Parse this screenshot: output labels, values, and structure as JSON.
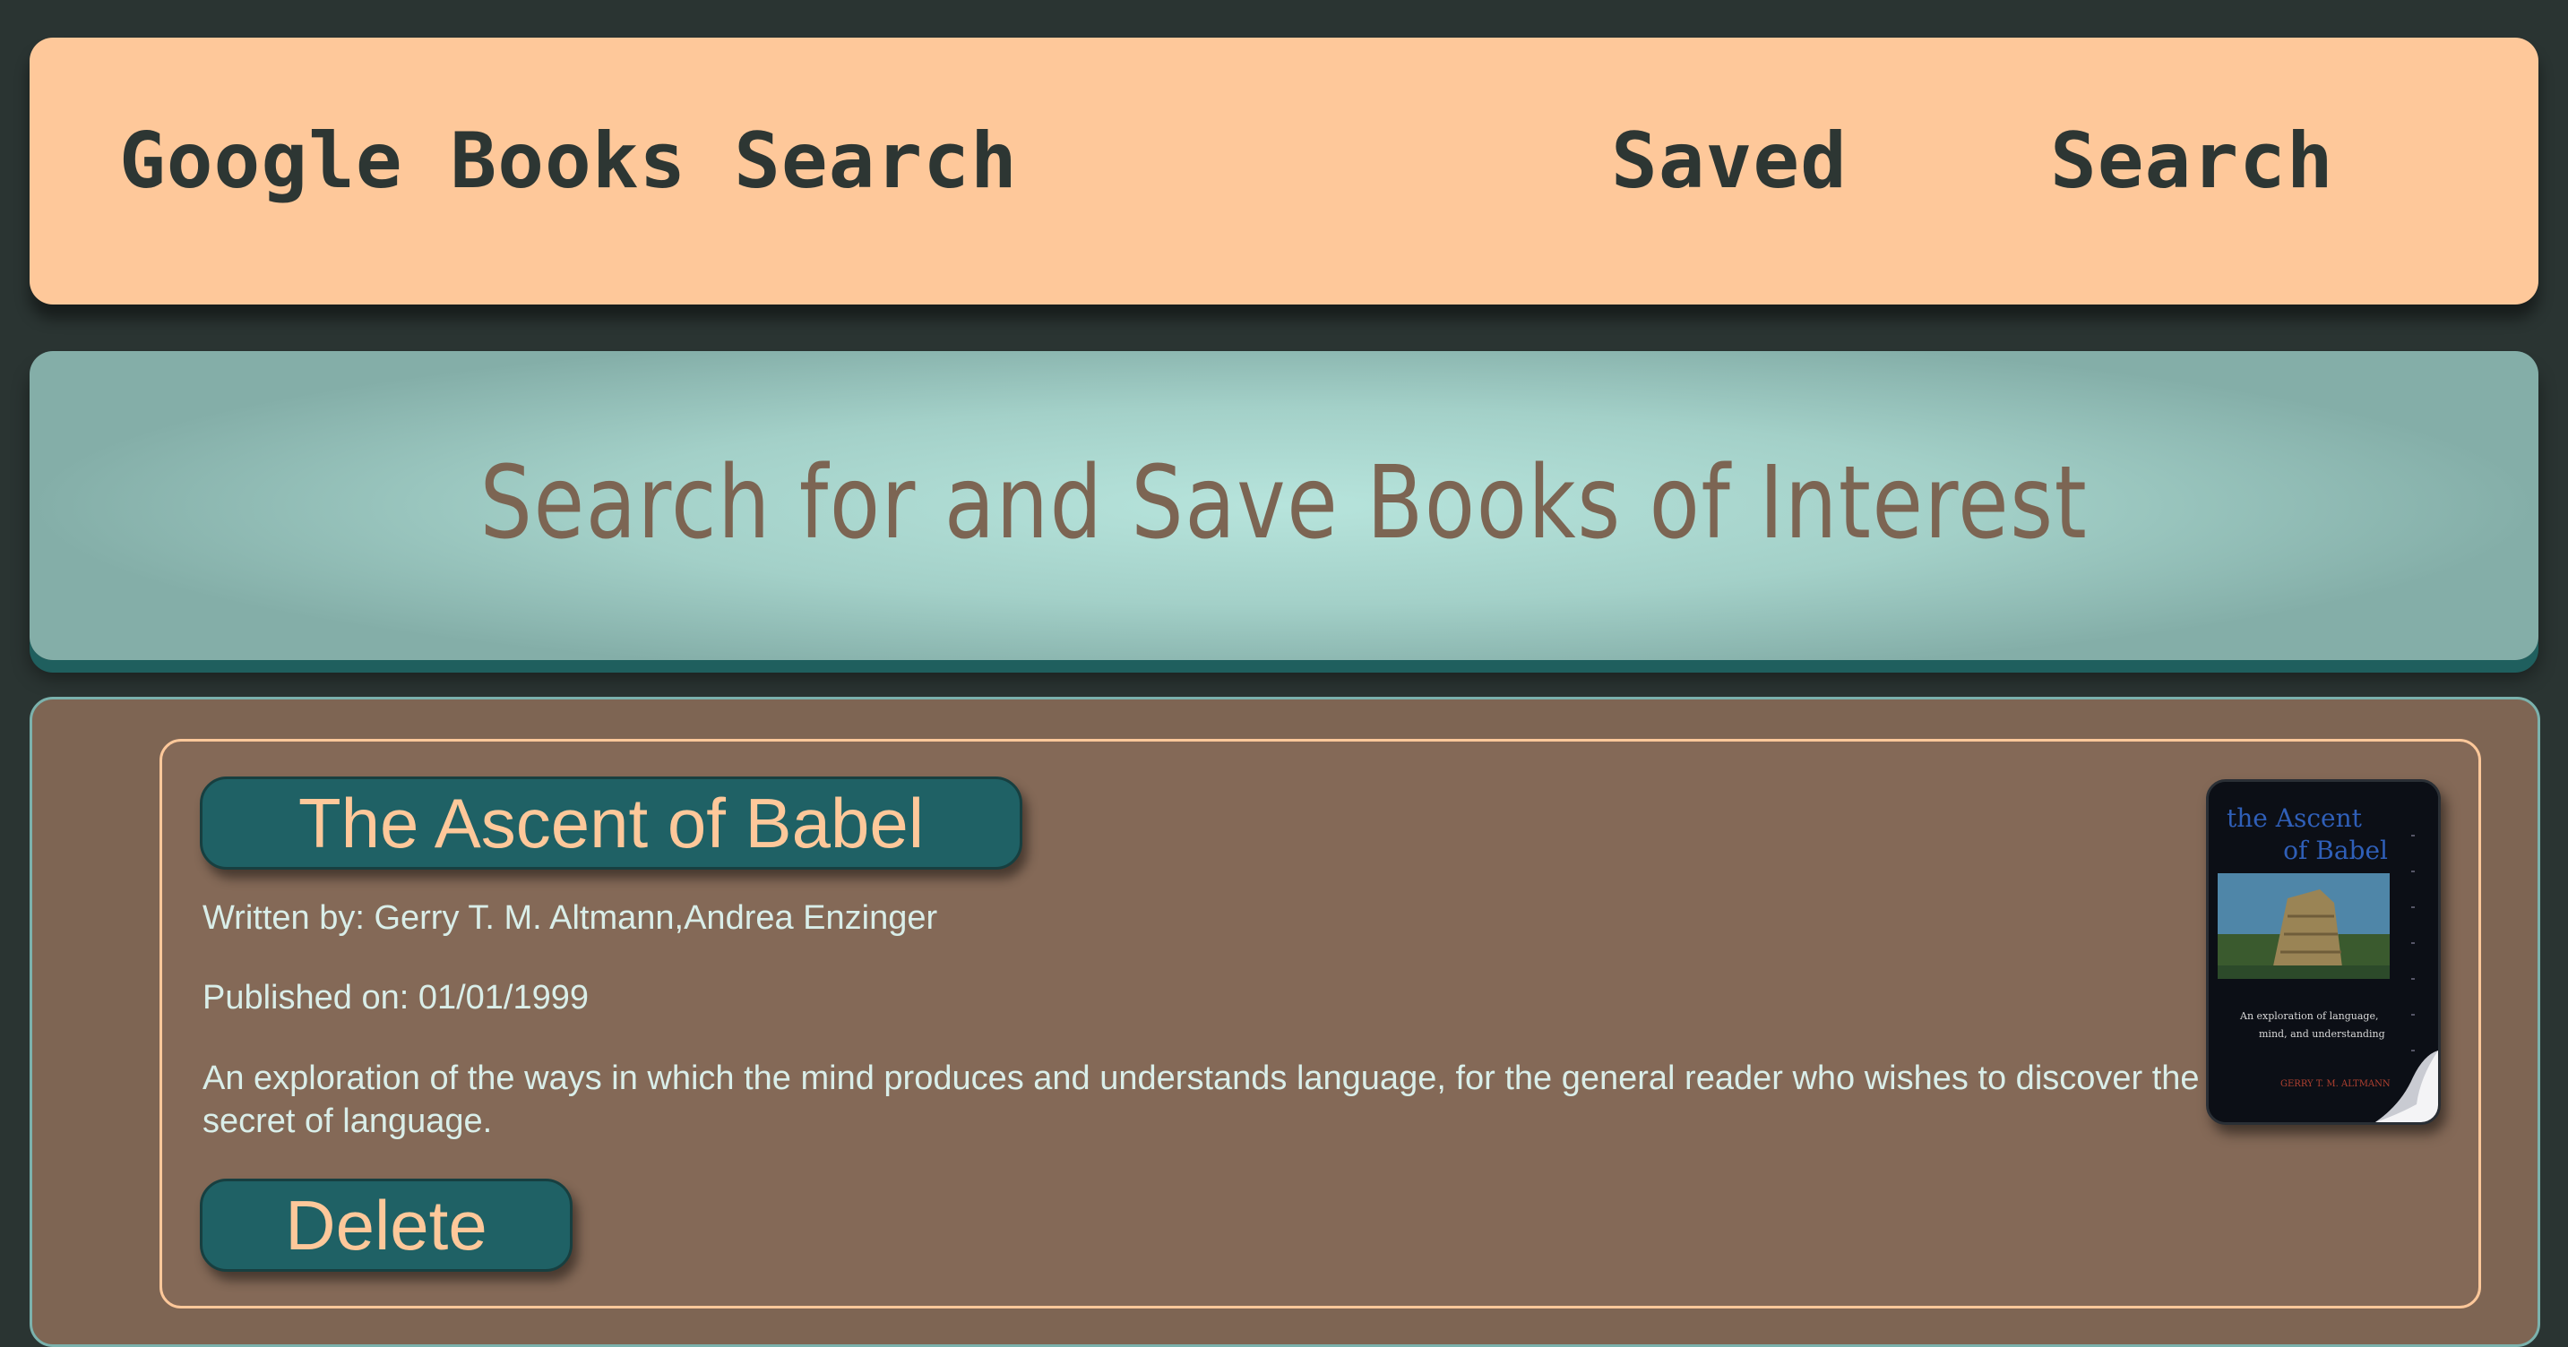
{
  "navbar": {
    "brand": "Google Books Search",
    "links": [
      {
        "label": "Saved"
      },
      {
        "label": "Search"
      }
    ]
  },
  "jumbotron": {
    "title": "Search for and Save Books of Interest"
  },
  "books": [
    {
      "title": "The Ascent of Babel",
      "authors": "Written by: Gerry T. M. Altmann,Andrea Enzinger",
      "published": "Published on: 01/01/1999",
      "description": "An exploration of the ways in which the mind produces and understands language, for the general reader who wishes to discover the secret of language.",
      "delete_label": "Delete",
      "cover": {
        "title_line1": "the Ascent",
        "title_line2": "of Babel",
        "subtitle_line1": "An exploration of language,",
        "subtitle_line2": "mind, and understanding",
        "author": "GERRY T. M. ALTMANN"
      }
    }
  ],
  "colors": {
    "background": "#2a3432",
    "navbar": "#fec89a",
    "jumbotron": "#a3d0c8",
    "card": "#846957",
    "button": "#1f6165",
    "button_text": "#fec89a",
    "body_text": "#d9eee9"
  }
}
